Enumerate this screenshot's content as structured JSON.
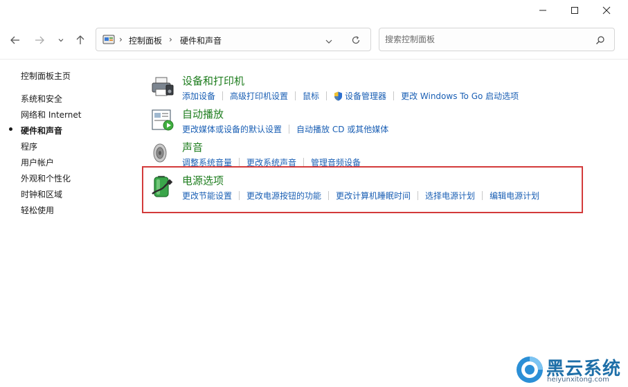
{
  "window": {
    "controls": {
      "minimize": "minimize-icon",
      "maximize": "maximize-icon",
      "close": "close-icon"
    }
  },
  "nav": {
    "breadcrumb": [
      "控制面板",
      "硬件和声音"
    ],
    "search_placeholder": "搜索控制面板"
  },
  "sidebar": {
    "home": "控制面板主页",
    "items": [
      {
        "label": "系统和安全",
        "active": false
      },
      {
        "label": "网络和 Internet",
        "active": false
      },
      {
        "label": "硬件和声音",
        "active": true
      },
      {
        "label": "程序",
        "active": false
      },
      {
        "label": "用户帐户",
        "active": false
      },
      {
        "label": "外观和个性化",
        "active": false
      },
      {
        "label": "时钟和区域",
        "active": false
      },
      {
        "label": "轻松使用",
        "active": false
      }
    ]
  },
  "categories": [
    {
      "title": "设备和打印机",
      "icon": "printer-icon",
      "links": [
        "添加设备",
        "高级打印机设置",
        "鼠标",
        "设备管理器",
        "更改 Windows To Go 启动选项"
      ]
    },
    {
      "title": "自动播放",
      "icon": "autoplay-icon",
      "links": [
        "更改媒体或设备的默认设置",
        "自动播放 CD 或其他媒体"
      ]
    },
    {
      "title": "声音",
      "icon": "speaker-icon",
      "links": [
        "调整系统音量",
        "更改系统声音",
        "管理音频设备"
      ]
    },
    {
      "title": "电源选项",
      "icon": "battery-icon",
      "links": [
        "更改节能设置",
        "更改电源按钮的功能",
        "更改计算机睡眠时间",
        "选择电源计划",
        "编辑电源计划"
      ]
    }
  ],
  "colors": {
    "link": "#1a5fb4",
    "category_title": "#1e7d1e",
    "highlight": "#d33a3a"
  },
  "watermark": {
    "brand": "黑云系统",
    "url": "heiyunxitong.com"
  }
}
